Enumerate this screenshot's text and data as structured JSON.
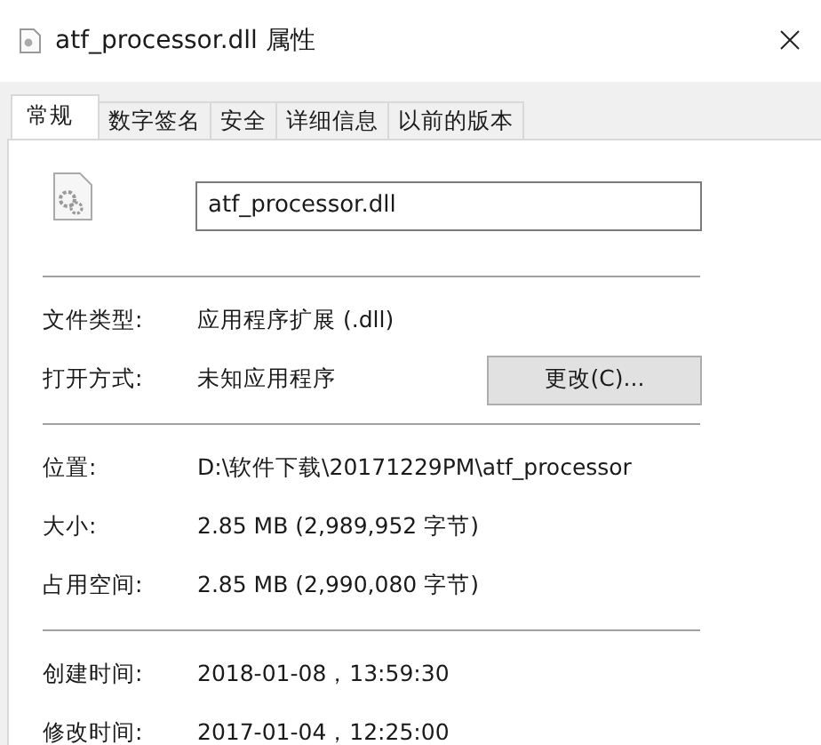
{
  "window": {
    "title": "atf_processor.dll 属性"
  },
  "tabs": [
    {
      "label": "常规",
      "selected": true
    },
    {
      "label": "数字签名",
      "selected": false
    },
    {
      "label": "安全",
      "selected": false
    },
    {
      "label": "详细信息",
      "selected": false
    },
    {
      "label": "以前的版本",
      "selected": false
    }
  ],
  "file_name": "atf_processor.dll",
  "sections": [
    [
      {
        "label": "文件类型:",
        "value": "应用程序扩展 (.dll)"
      },
      {
        "label": "打开方式:",
        "value": "未知应用程序",
        "button": "更改(C)..."
      }
    ],
    [
      {
        "label": "位置:",
        "value": "D:\\软件下载\\20171229PM\\atf_processor"
      },
      {
        "label": "大小:",
        "value": "2.85 MB (2,989,952 字节)"
      },
      {
        "label": "占用空间:",
        "value": "2.85 MB (2,990,080 字节)"
      }
    ],
    [
      {
        "label": "创建时间:",
        "value": "2018-01-08，13:59:30"
      },
      {
        "label": "修改时间:",
        "value": "2017-01-04，12:25:00"
      }
    ]
  ]
}
